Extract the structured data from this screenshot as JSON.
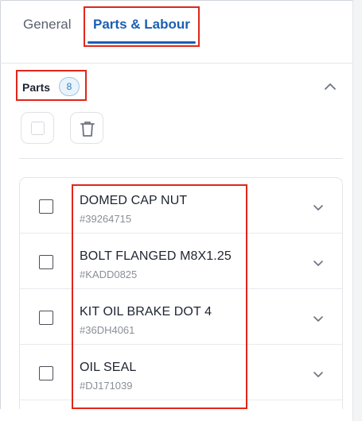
{
  "tabs": [
    {
      "label": "General",
      "active": false
    },
    {
      "label": "Parts & Labour",
      "active": true
    }
  ],
  "parts_section": {
    "title": "Parts",
    "count": "8",
    "collapse_icon": "chevron-up-icon",
    "toolbar": {
      "select_all_icon": "checkbox-icon",
      "delete_icon": "trash-icon"
    }
  },
  "parts": [
    {
      "name": "DOMED CAP NUT",
      "code": "#39264715"
    },
    {
      "name": "BOLT FLANGED M8X1.25",
      "code": "#KADD0825"
    },
    {
      "name": "KIT OIL BRAKE DOT 4",
      "code": "#36DH4061"
    },
    {
      "name": "OIL SEAL",
      "code": "#DJ171039"
    }
  ],
  "colors": {
    "accent": "#1a5fb4",
    "highlight": "#e0261b",
    "badge_bg": "#e8f3fb",
    "muted_text": "#8a8f98"
  }
}
